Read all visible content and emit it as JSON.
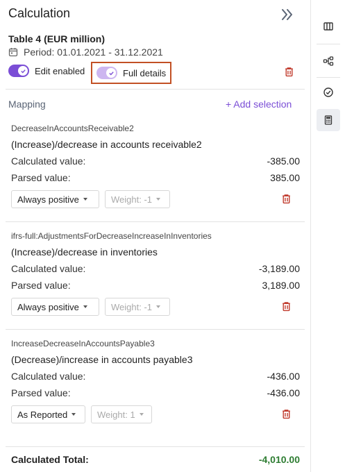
{
  "panel": {
    "title": "Calculation",
    "table_title": "Table 4 (EUR million)",
    "period": "Period: 01.01.2021 - 31.12.2021",
    "edit_label": "Edit enabled",
    "full_details_label": "Full details",
    "mapping_label": "Mapping",
    "add_selection": "+ Add selection"
  },
  "items": [
    {
      "tag": "DecreaseInAccountsReceivable2",
      "name": "(Increase)/decrease in accounts receivable2",
      "calc_label": "Calculated value:",
      "calc_value": "-385.00",
      "parsed_label": "Parsed value:",
      "parsed_value": "385.00",
      "sign_option": "Always positive",
      "weight": "Weight: -1"
    },
    {
      "tag": "ifrs-full:AdjustmentsForDecreaseIncreaseInInventories",
      "name": "(Increase)/decrease in inventories",
      "calc_label": "Calculated value:",
      "calc_value": "-3,189.00",
      "parsed_label": "Parsed value:",
      "parsed_value": "3,189.00",
      "sign_option": "Always positive",
      "weight": "Weight: -1"
    },
    {
      "tag": "IncreaseDecreaseInAccountsPayable3",
      "name": "(Decrease)/increase in accounts payable3",
      "calc_label": "Calculated value:",
      "calc_value": "-436.00",
      "parsed_label": "Parsed value:",
      "parsed_value": "-436.00",
      "sign_option": "As Reported",
      "weight": "Weight: 1"
    }
  ],
  "total": {
    "label": "Calculated Total:",
    "value": "-4,010.00"
  },
  "colors": {
    "accent": "#7b4ed6",
    "danger": "#c0392b",
    "positive": "#2e7d32",
    "highlight_border": "#c25024"
  },
  "icons": {
    "collapse": "double-chevron-right-icon",
    "calendar": "calendar-icon",
    "delete": "trash-icon",
    "rail": [
      "split-panel-icon",
      "hierarchy-icon",
      "check-circle-icon",
      "calculator-icon"
    ]
  }
}
